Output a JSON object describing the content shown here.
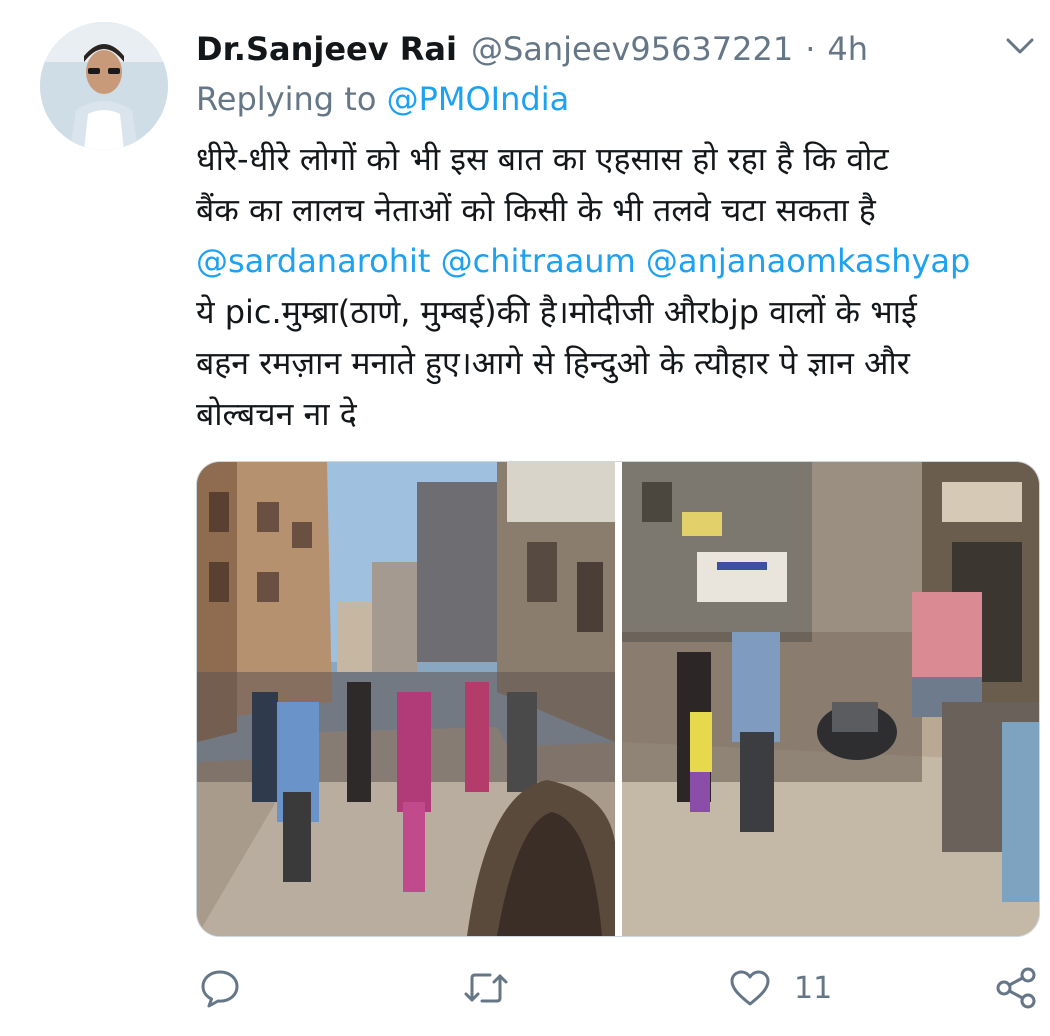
{
  "tweet": {
    "author_name": "Dr.Sanjeev Rai",
    "handle": "@Sanjeev95637221",
    "separator": "·",
    "time": "4h",
    "replying_prefix": "Replying to",
    "replying_to": "@PMOIndia",
    "line1": "धीरे-धीरे लोगों को भी इस बात का एहसास हो रहा है कि वोट",
    "line2": "बैंक का लालच नेताओं को किसी के भी तलवे चटा सकता है",
    "mentions": "@sardanarohit @chitraaum @anjanaomkashyap",
    "line4": "ये pic.मुम्ब्रा(ठाणे, मुम्बई)की है।मोदीजी औरbjp वालों के भाई",
    "line5": "बहन रमज़ान मनाते हुए।आगे से हिन्दुओ के त्यौहार पे ज्ञान और",
    "line6": "बोल्बचन ना दे"
  },
  "actions": {
    "like_count": "11"
  },
  "colors": {
    "link": "#1da1f2",
    "secondary": "#657786",
    "text": "#14171a"
  },
  "icons": [
    "chevron-down-icon",
    "reply-icon",
    "retweet-icon",
    "like-icon",
    "share-icon"
  ]
}
